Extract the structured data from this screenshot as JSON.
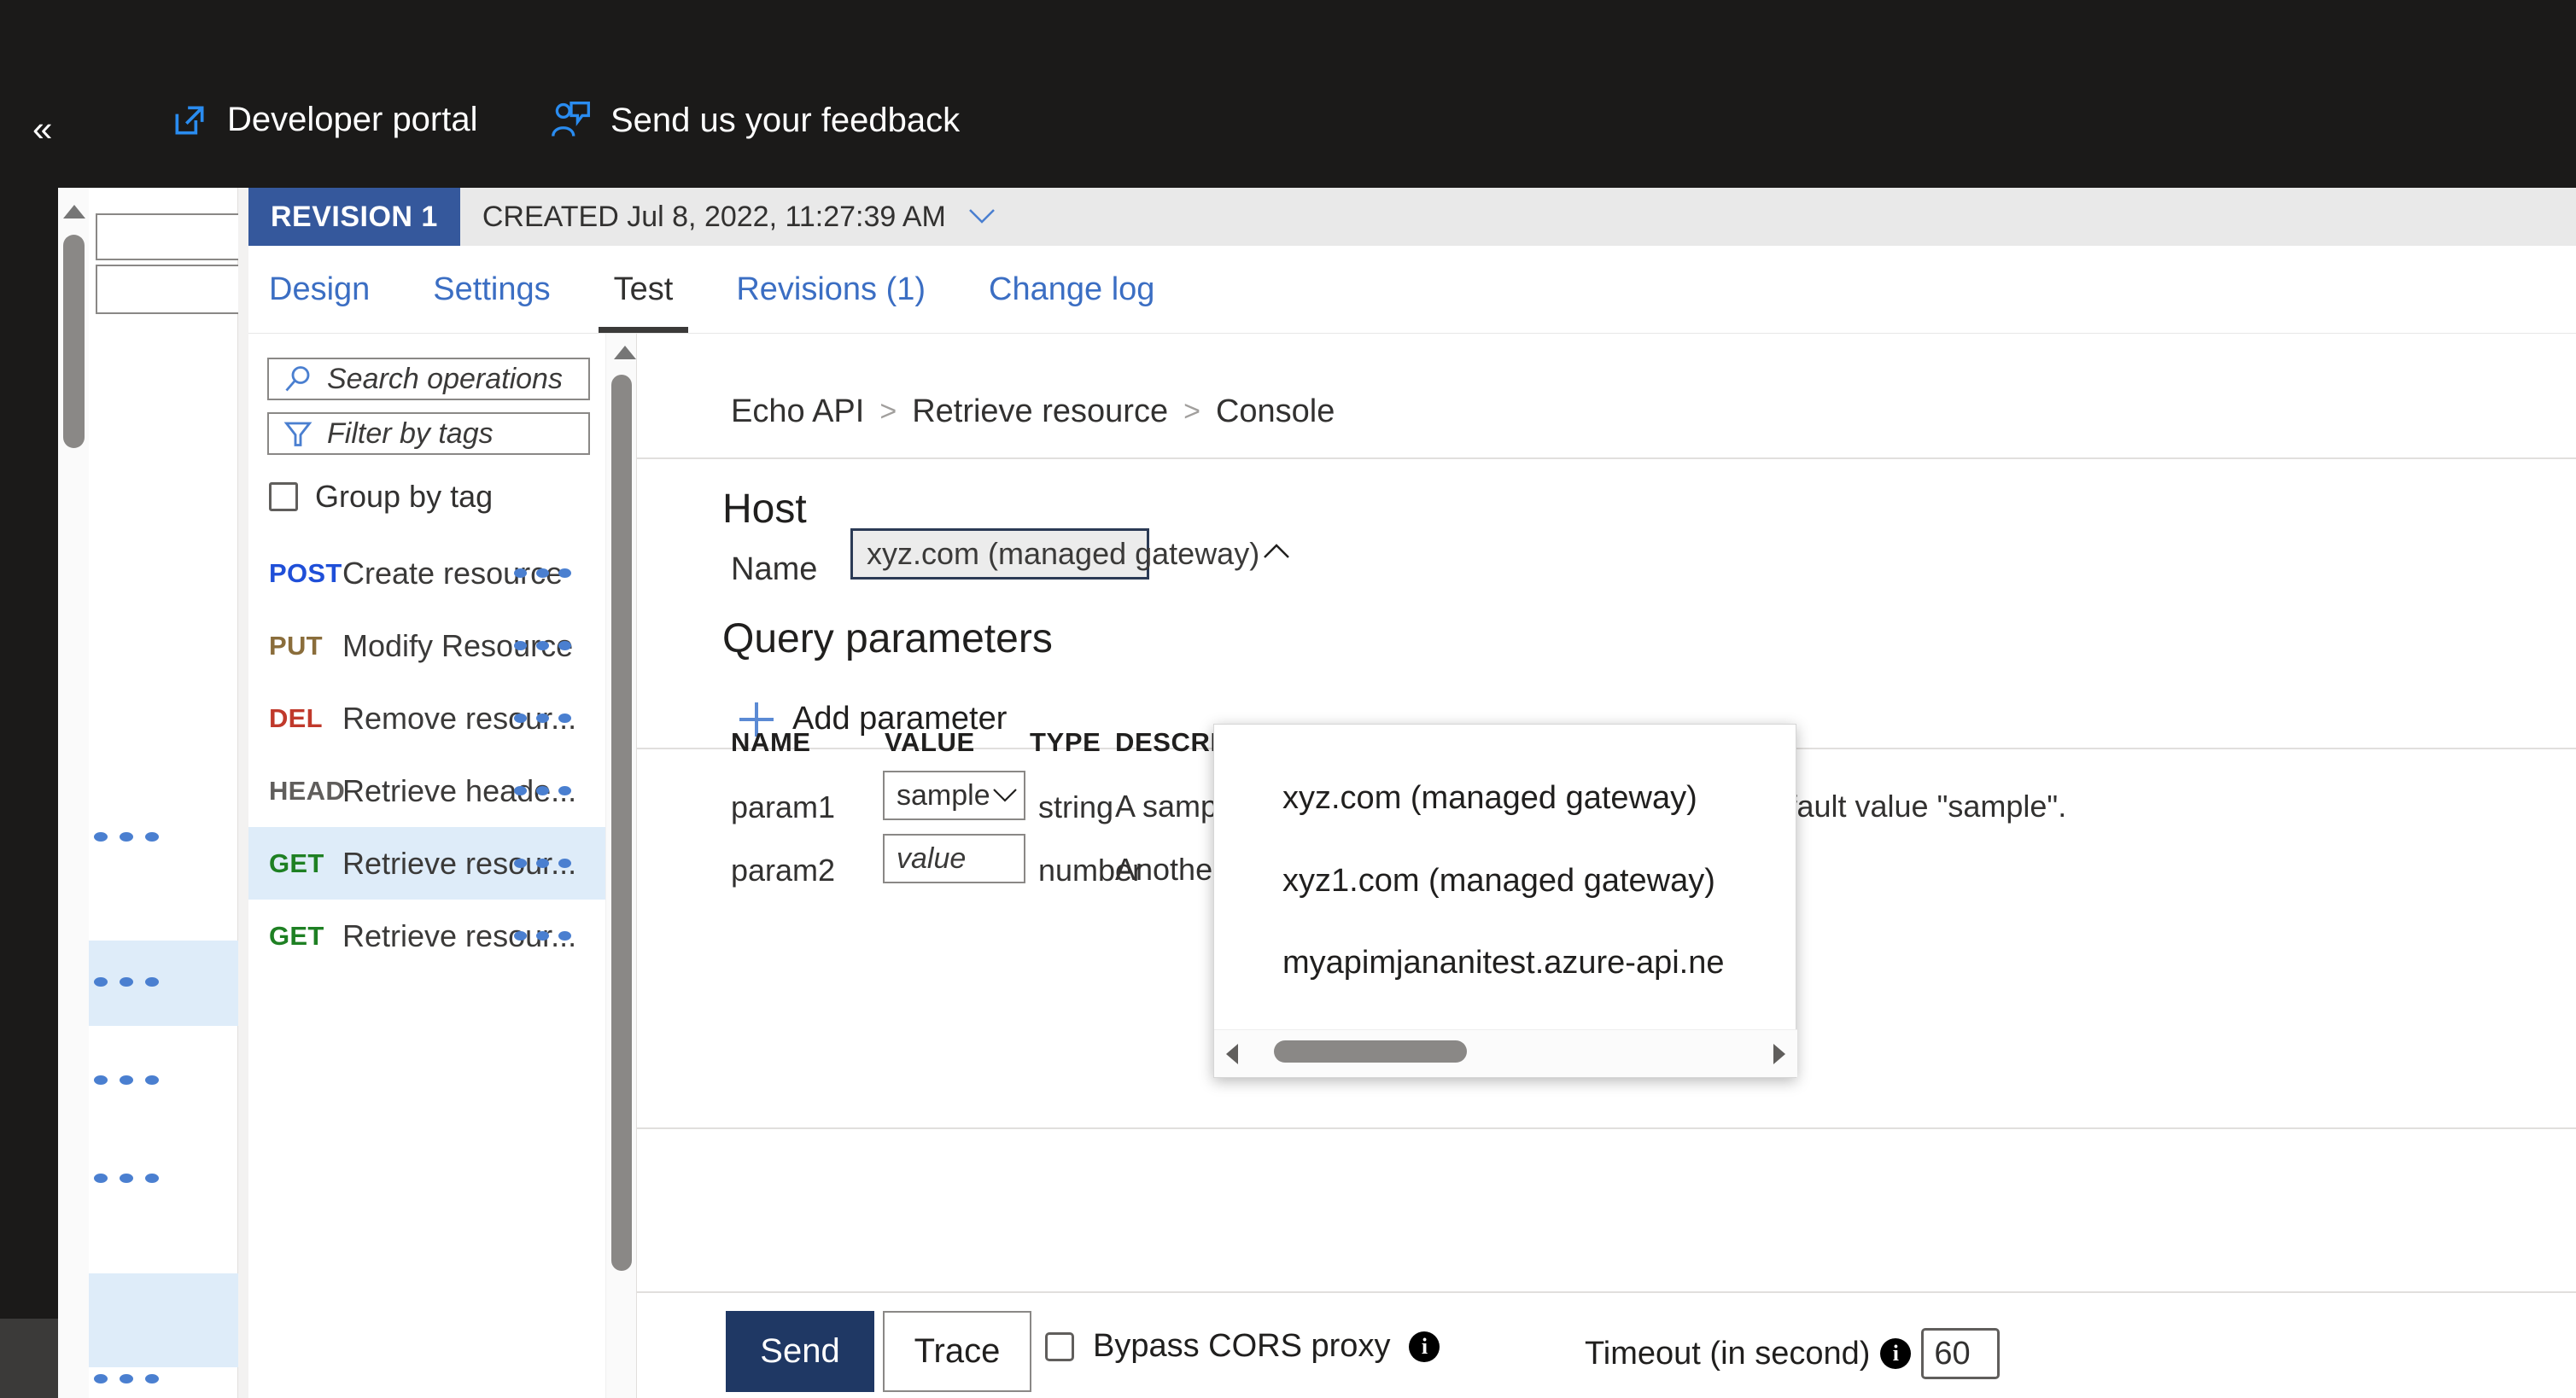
{
  "topbar": {
    "collapse_icon": "chevron-double-left-icon",
    "commands": [
      {
        "label": "Developer portal",
        "icon": "external-link-icon"
      },
      {
        "label": "Send us your feedback",
        "icon": "feedback-person-icon"
      }
    ]
  },
  "revision": {
    "badge": "REVISION 1",
    "created_label": "CREATED Jul 8, 2022, 11:27:39 AM",
    "chevron": "chevron-down-icon",
    "badge_color": "#35589c"
  },
  "tabs": [
    {
      "label": "Design",
      "active": false
    },
    {
      "label": "Settings",
      "active": false
    },
    {
      "label": "Test",
      "active": true
    },
    {
      "label": "Revisions (1)",
      "active": false
    },
    {
      "label": "Change log",
      "active": false
    }
  ],
  "operations_pane": {
    "search_placeholder": "Search operations",
    "filter_placeholder": "Filter by tags",
    "group_by_tag_label": "Group by tag",
    "group_by_tag_checked": false,
    "items": [
      {
        "verb": "POST",
        "verb_class": "post",
        "name": "Create resource",
        "selected": false
      },
      {
        "verb": "PUT",
        "verb_class": "put",
        "name": "Modify Resource",
        "selected": false
      },
      {
        "verb": "DEL",
        "verb_class": "del",
        "name": "Remove resour...",
        "selected": false
      },
      {
        "verb": "HEAD",
        "verb_class": "head",
        "name": "Retrieve heade...",
        "selected": false
      },
      {
        "verb": "GET",
        "verb_class": "get",
        "name": "Retrieve resour...",
        "selected": true
      },
      {
        "verb": "GET",
        "verb_class": "get",
        "name": "Retrieve resour...",
        "selected": false
      }
    ]
  },
  "console": {
    "breadcrumb": [
      "Echo API",
      "Retrieve resource",
      "Console"
    ],
    "breadcrumb_separator": ">",
    "host_heading": "Host",
    "name_label": "Name",
    "host_selected": "xyz.com (managed gateway)",
    "host_chevron": "chevron-up-icon",
    "host_options": [
      "xyz.com (managed gateway)",
      "xyz1.com (managed gateway)",
      "myapimjananitest.azure-api.ne"
    ],
    "query_heading": "Query parameters",
    "add_parameter_label": "Add parameter",
    "table_headers": {
      "name": "NAME",
      "value": "VALUE",
      "type": "TYPE",
      "description": "DESCRIPTION"
    },
    "rows": [
      {
        "name": "param1",
        "value": "sample",
        "value_is_placeholder": false,
        "type": "string",
        "description": "A sample parameter that is required and has a default value \"sample\"."
      },
      {
        "name": "param2",
        "value": "value",
        "value_is_placeholder": true,
        "type": "number",
        "description": "Another sample parameter, set to not required."
      }
    ],
    "actions": {
      "send_label": "Send",
      "trace_label": "Trace",
      "bypass_cors_label": "Bypass CORS proxy",
      "bypass_cors_checked": false,
      "timeout_label": "Timeout (in second)",
      "timeout_value": "60",
      "info_glyph": "i"
    }
  },
  "colors": {
    "accent_blue": "#3b6ec3",
    "send_button": "#1f3864",
    "selected_row": "#deecf9",
    "revision_badge": "#35589c",
    "topbar": "#1b1a19"
  }
}
